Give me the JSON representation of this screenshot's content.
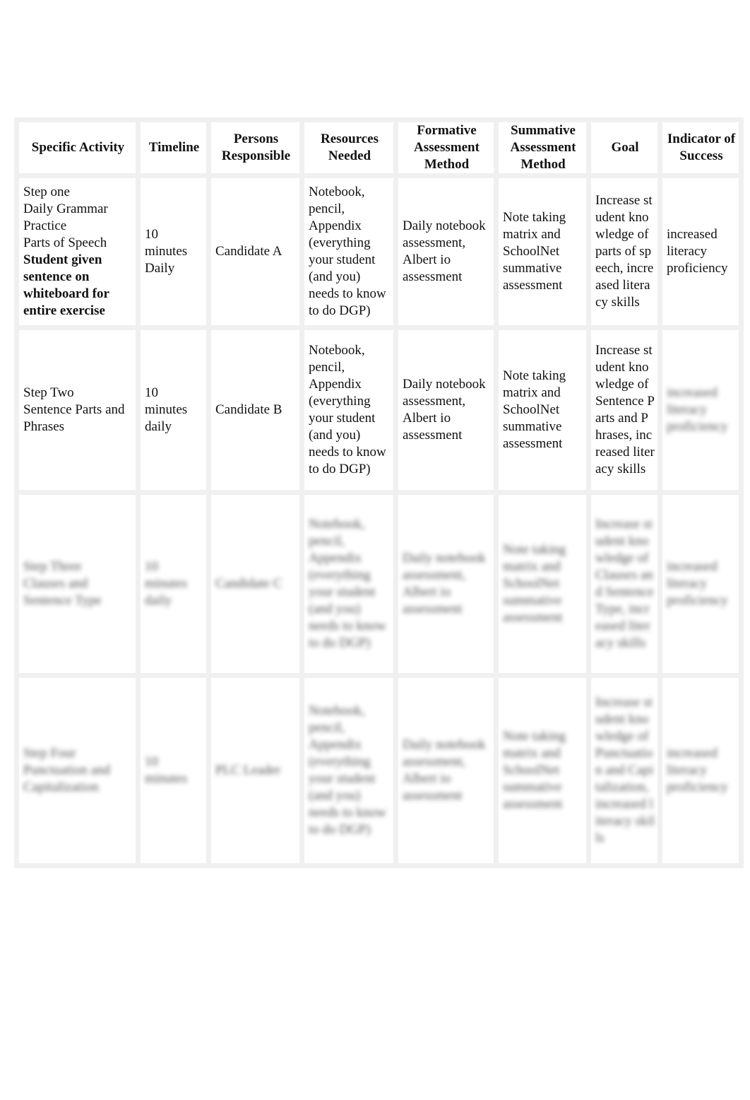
{
  "table": {
    "headers": [
      "Specific Activity",
      "Timeline",
      "Persons Responsible",
      "Resources Needed",
      "Formative Assessment Method",
      "Summative Assessment Method",
      "Goal",
      "Indicator of Success"
    ],
    "rows": [
      {
        "activity_lines": [
          "Step one",
          "Daily Grammar Practice",
          "Parts of Speech"
        ],
        "activity_bold": "Student given sentence on whiteboard for entire exercise",
        "timeline": "10 minutes Daily",
        "persons": "Candidate A",
        "resources": "Notebook, pencil, Appendix (everything your student (and you) needs to know to do DGP)",
        "formative": "Daily notebook assessment, Albert io assessment",
        "summative": "Note taking matrix and SchoolNet summative assessment",
        "goal": "Increase student knowledge of parts of speech, increased literacy skills",
        "indicator": "increased literacy proficiency"
      },
      {
        "activity_lines": [
          "Step Two",
          "Sentence Parts and Phrases"
        ],
        "activity_bold": "",
        "timeline": "10 minutes daily",
        "persons": "Candidate B",
        "resources": "Notebook, pencil, Appendix (everything your student (and you) needs to know to do DGP)",
        "formative": "Daily notebook assessment, Albert io assessment",
        "summative": "Note taking matrix and SchoolNet summative assessment",
        "goal": "Increase student knowledge of Sentence Parts and Phrases, increased literacy skills",
        "indicator": "increased literacy proficiency"
      },
      {
        "activity_lines": [
          "Step Three",
          "Clauses and Sentence Type"
        ],
        "activity_bold": "",
        "timeline": "10 minutes daily",
        "persons": "Candidate C",
        "resources": "Notebook, pencil, Appendix (everything your student (and you) needs to know to do DGP)",
        "formative": "Daily notebook assessment, Albert io assessment",
        "summative": "Note taking matrix and SchoolNet summative assessment",
        "goal": "Increase student knowledge of Clauses and Sentence Type, increased literacy skills",
        "indicator": "increased literacy proficiency"
      },
      {
        "activity_lines": [
          "Step Four",
          "Punctuation and Capitalization"
        ],
        "activity_bold": "",
        "timeline": "10 minutes",
        "persons": "PLC Leader",
        "resources": "Notebook, pencil, Appendix (everything your student (and you) needs to know to do DGP)",
        "formative": "Daily notebook assessment, Albert io assessment",
        "summative": "Note taking matrix and SchoolNet summative assessment",
        "goal": "Increase student knowledge of Punctuation and Capitalization, increased literacy skills",
        "indicator": "increased literacy proficiency"
      }
    ]
  }
}
